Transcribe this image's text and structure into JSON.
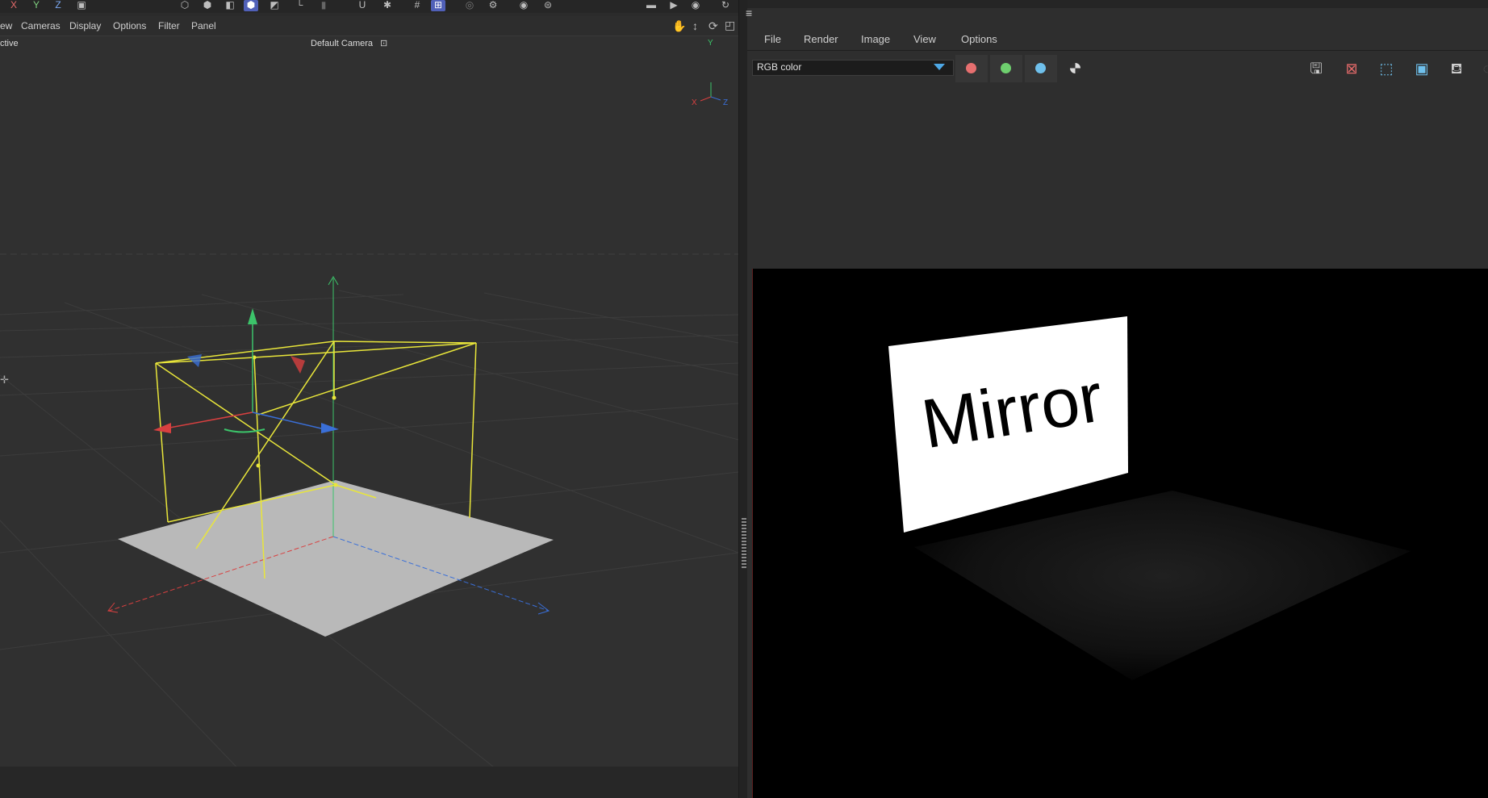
{
  "toolbar": {
    "axis_x": "X",
    "axis_y": "Y",
    "axis_z": "Z"
  },
  "viewport": {
    "menu": [
      "ew",
      "Cameras",
      "Display",
      "Options",
      "Filter",
      "Panel"
    ],
    "view_label": "ctive",
    "camera_label": "Default Camera",
    "axis_labels": {
      "y": "Y",
      "x": "X",
      "z": "Z"
    }
  },
  "render_panel": {
    "menu": [
      "File",
      "Render",
      "Image",
      "View",
      "Options"
    ],
    "channel_select": "RGB color",
    "channel_swatches": {
      "red": "#e66f6f",
      "green": "#6ecf6e",
      "blue": "#6fc0ec"
    },
    "render_text": "Mirror"
  },
  "colors": {
    "accent": "#5060b8",
    "dropdown_arrow": "#4ea8e6",
    "wireframe": "#e9e63a",
    "axis_x": "#d84040",
    "axis_y": "#3cc46a",
    "axis_z": "#3a6fd8"
  }
}
